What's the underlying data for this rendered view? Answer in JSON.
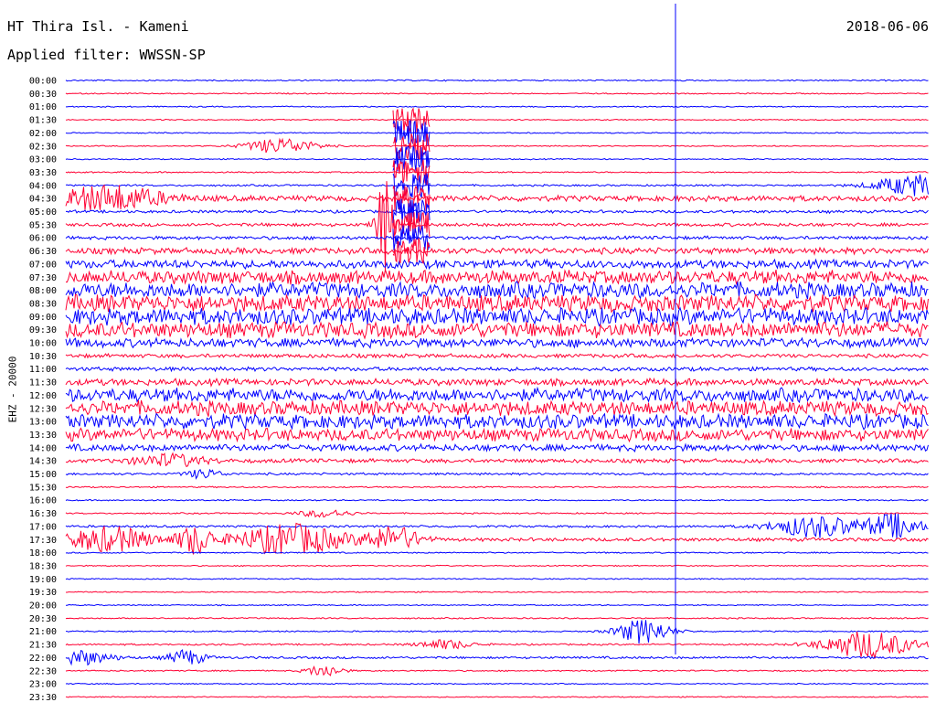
{
  "header": {
    "title": "HT Thira Isl. - Kameni",
    "filter": "Applied filter: WWSSN-SP",
    "date": "2018-06-06"
  },
  "colors": {
    "odd_trace": "#0000ff",
    "even_trace": "#ff0033"
  },
  "chart_data": {
    "type": "line",
    "title": "HT Thira Isl. - Kameni",
    "subtitle": "Applied filter: WWSSN-SP",
    "ylabel": "EHZ - 20000",
    "xlabel": "",
    "trace_minutes": 30,
    "traces": [
      {
        "t": "00:00",
        "amp": 0.12,
        "events": []
      },
      {
        "t": "00:30",
        "amp": 0.1,
        "events": []
      },
      {
        "t": "01:00",
        "amp": 0.1,
        "events": []
      },
      {
        "t": "01:30",
        "amp": 0.1,
        "events": []
      },
      {
        "t": "02:00",
        "amp": 0.1,
        "events": []
      },
      {
        "t": "02:30",
        "amp": 0.1,
        "events": [
          [
            0.25,
            10,
            0.04
          ]
        ]
      },
      {
        "t": "03:00",
        "amp": 0.1,
        "events": []
      },
      {
        "t": "03:30",
        "amp": 0.12,
        "events": []
      },
      {
        "t": "04:00",
        "amp": 0.16,
        "events": [
          [
            0.99,
            14,
            0.05
          ]
        ]
      },
      {
        "t": "04:30",
        "amp": 0.5,
        "events": [
          [
            0.05,
            16,
            0.06
          ]
        ]
      },
      {
        "t": "05:00",
        "amp": 0.25,
        "events": []
      },
      {
        "t": "05:30",
        "amp": 0.3,
        "events": [
          [
            0.37,
            60,
            0.01
          ]
        ]
      },
      {
        "t": "06:00",
        "amp": 0.3,
        "events": []
      },
      {
        "t": "06:30",
        "amp": 0.55,
        "events": []
      },
      {
        "t": "07:00",
        "amp": 0.75,
        "events": []
      },
      {
        "t": "07:30",
        "amp": 1.2,
        "events": []
      },
      {
        "t": "08:00",
        "amp": 1.4,
        "events": []
      },
      {
        "t": "08:30",
        "amp": 1.5,
        "events": []
      },
      {
        "t": "09:00",
        "amp": 1.5,
        "events": []
      },
      {
        "t": "09:30",
        "amp": 1.4,
        "events": []
      },
      {
        "t": "10:00",
        "amp": 0.8,
        "events": []
      },
      {
        "t": "10:30",
        "amp": 0.35,
        "events": []
      },
      {
        "t": "11:00",
        "amp": 0.35,
        "events": []
      },
      {
        "t": "11:30",
        "amp": 0.6,
        "events": []
      },
      {
        "t": "12:00",
        "amp": 1.2,
        "events": []
      },
      {
        "t": "12:30",
        "amp": 1.3,
        "events": []
      },
      {
        "t": "13:00",
        "amp": 1.3,
        "events": []
      },
      {
        "t": "13:30",
        "amp": 1.1,
        "events": []
      },
      {
        "t": "14:00",
        "amp": 0.6,
        "events": []
      },
      {
        "t": "14:30",
        "amp": 0.35,
        "events": [
          [
            0.12,
            8,
            0.04
          ]
        ]
      },
      {
        "t": "15:00",
        "amp": 0.2,
        "events": [
          [
            0.16,
            6,
            0.02
          ]
        ]
      },
      {
        "t": "15:30",
        "amp": 0.12,
        "events": []
      },
      {
        "t": "16:00",
        "amp": 0.12,
        "events": []
      },
      {
        "t": "16:30",
        "amp": 0.12,
        "events": [
          [
            0.3,
            5,
            0.03
          ]
        ]
      },
      {
        "t": "17:00",
        "amp": 0.2,
        "events": [
          [
            0.87,
            14,
            0.05
          ],
          [
            0.96,
            16,
            0.03
          ]
        ]
      },
      {
        "t": "17:30",
        "amp": 0.3,
        "events": [
          [
            0.05,
            16,
            0.05
          ],
          [
            0.15,
            18,
            0.02
          ],
          [
            0.26,
            20,
            0.06
          ],
          [
            0.38,
            16,
            0.03
          ]
        ]
      },
      {
        "t": "18:00",
        "amp": 0.12,
        "events": []
      },
      {
        "t": "18:30",
        "amp": 0.1,
        "events": []
      },
      {
        "t": "19:00",
        "amp": 0.1,
        "events": []
      },
      {
        "t": "19:30",
        "amp": 0.1,
        "events": []
      },
      {
        "t": "20:00",
        "amp": 0.1,
        "events": []
      },
      {
        "t": "20:30",
        "amp": 0.12,
        "events": []
      },
      {
        "t": "21:00",
        "amp": 0.12,
        "events": [
          [
            0.67,
            16,
            0.03
          ]
        ]
      },
      {
        "t": "21:30",
        "amp": 0.15,
        "events": [
          [
            0.44,
            6,
            0.03
          ],
          [
            0.93,
            18,
            0.05
          ]
        ]
      },
      {
        "t": "22:00",
        "amp": 0.2,
        "events": [
          [
            0.01,
            10,
            0.04
          ],
          [
            0.14,
            10,
            0.02
          ]
        ]
      },
      {
        "t": "22:30",
        "amp": 0.12,
        "events": [
          [
            0.3,
            8,
            0.02
          ]
        ]
      },
      {
        "t": "23:00",
        "amp": 0.1,
        "events": []
      },
      {
        "t": "23:30",
        "amp": 0.1,
        "events": []
      }
    ]
  }
}
